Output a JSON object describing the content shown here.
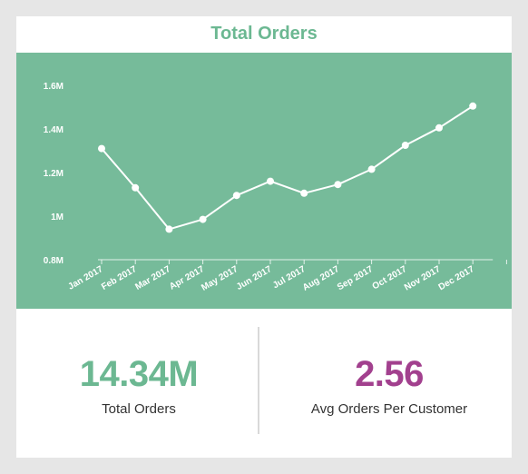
{
  "colors": {
    "title": "#6cb892",
    "chart_bg": "#76bb9a",
    "line": "#ffffff",
    "axis_text": "#ffffff",
    "kpi_total": "#6cb892",
    "kpi_avg": "#a2408e"
  },
  "chart_data": {
    "type": "line",
    "title": "Total Orders",
    "xlabel": "",
    "ylabel": "",
    "categories": [
      "Jan 2017",
      "Feb 2017",
      "Mar 2017",
      "Apr 2017",
      "May 2017",
      "Jun 2017",
      "Jul 2017",
      "Aug 2017",
      "Sep 2017",
      "Oct 2017",
      "Nov 2017",
      "Dec 2017"
    ],
    "values": [
      1310000,
      1130000,
      940000,
      985000,
      1095000,
      1160000,
      1105000,
      1145000,
      1215000,
      1325000,
      1405000,
      1505000
    ],
    "ylim": [
      800000,
      1600000
    ],
    "yticks": [
      800000,
      1000000,
      1200000,
      1400000,
      1600000
    ],
    "ytick_labels": [
      "0.8M",
      "1M",
      "1.2M",
      "1.4M",
      "1.6M"
    ],
    "grid": false,
    "legend": "none"
  },
  "kpis": {
    "total_orders_value": "14.34M",
    "total_orders_label": "Total Orders",
    "avg_orders_value": "2.56",
    "avg_orders_label": "Avg Orders Per Customer"
  }
}
